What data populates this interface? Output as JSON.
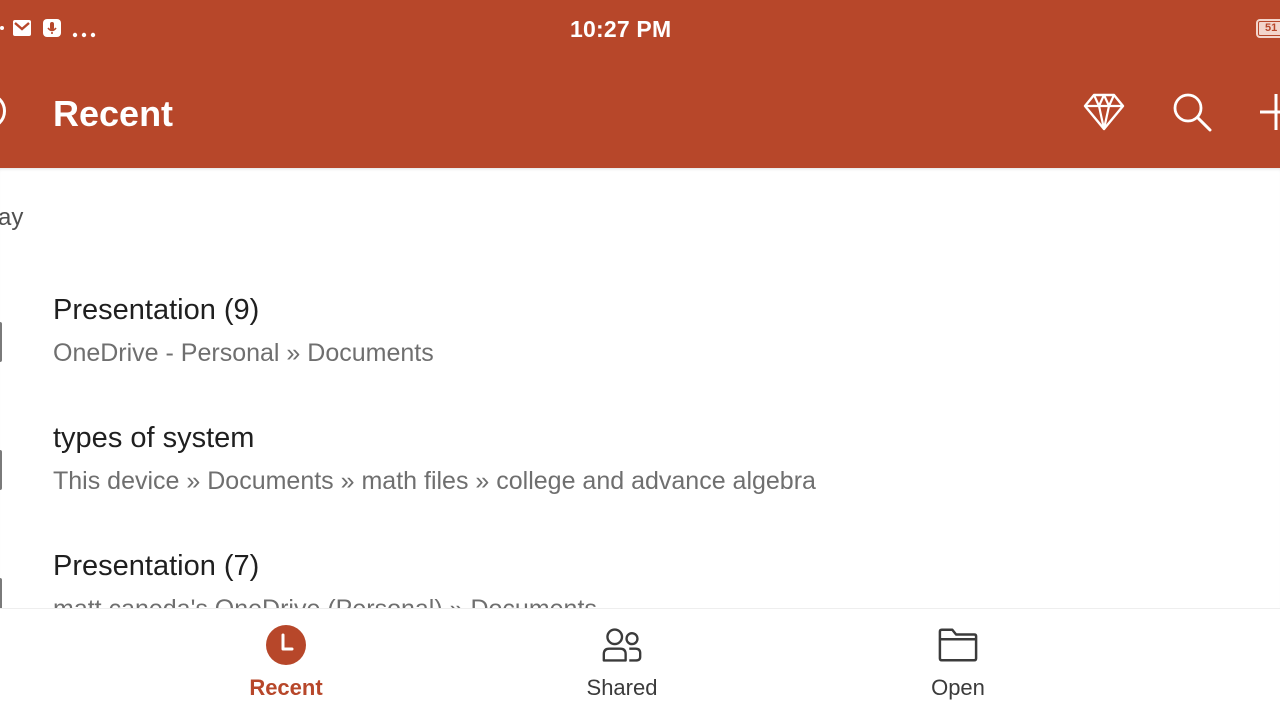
{
  "status_bar": {
    "time": "10:27 PM",
    "battery_level": "51",
    "icons": [
      "gmail-icon",
      "microphone-icon",
      "more-dots-icon"
    ]
  },
  "header": {
    "title": "Recent",
    "actions": [
      "premium-diamond-icon",
      "search-icon",
      "add-icon"
    ]
  },
  "content": {
    "section_label": "ay",
    "files": [
      {
        "name": "Presentation (9)",
        "path": "OneDrive - Personal » Documents"
      },
      {
        "name": "types of system",
        "path": "This device » Documents » math files » college and advance algebra"
      },
      {
        "name": "Presentation (7)",
        "path": "matt caneda's OneDrive (Personal) » Documents"
      }
    ]
  },
  "bottom_nav": {
    "items": [
      {
        "label": "Recent",
        "active": true
      },
      {
        "label": "Shared",
        "active": false
      },
      {
        "label": "Open",
        "active": false
      }
    ]
  },
  "colors": {
    "brand": "#b7472a",
    "header_text": "#ffffff",
    "path_text": "#6f6f6f",
    "nav_text": "#3b3b3b"
  }
}
